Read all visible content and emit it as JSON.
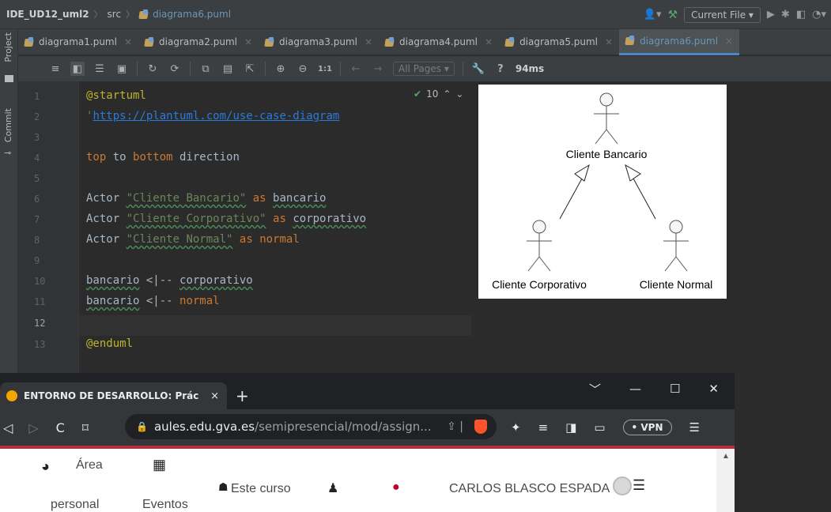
{
  "ide": {
    "breadcrumb": {
      "project": "IDE_UD12_uml2",
      "folder": "src",
      "file": "diagrama6.puml"
    },
    "run_config": "Current File ▾",
    "tool_windows": {
      "project": "Project",
      "commit": "Commit"
    },
    "tabs": [
      {
        "label": "diagrama1.puml",
        "active": false
      },
      {
        "label": "diagrama2.puml",
        "active": false
      },
      {
        "label": "diagrama3.puml",
        "active": false
      },
      {
        "label": "diagrama4.puml",
        "active": false
      },
      {
        "label": "diagrama5.puml",
        "active": false
      },
      {
        "label": "diagrama6.puml",
        "active": true
      }
    ],
    "toolbar": {
      "zoom_actual": "1:1",
      "pages": "All Pages",
      "help": "?",
      "timing": "94ms"
    },
    "inspections": {
      "count": "10"
    },
    "editor": {
      "line_numbers": [
        "1",
        "2",
        "3",
        "4",
        "5",
        "6",
        "7",
        "8",
        "9",
        "10",
        "11",
        "12",
        "13"
      ],
      "current_line": "12",
      "lines": [
        "@startuml",
        "'https://plantuml.com/use-case-diagram",
        "",
        "top to bottom direction",
        "",
        "Actor \"Cliente Bancario\" as bancario",
        "Actor \"Cliente Corporativo\" as corporativo",
        "Actor \"Cliente Normal\" as normal",
        "",
        "bancario <|-- corporativo",
        "bancario <|-- normal",
        "",
        "@enduml"
      ],
      "tokens": {
        "l1": "@startuml",
        "l2_quote": "'",
        "l2_url": "https://plantuml.com/use-case-diagram",
        "l4_kw1": "top",
        "l4_t1": " to ",
        "l4_kw2": "bottom",
        "l4_t2": " direction",
        "actor": "Actor",
        "as": "as",
        "l6_str": "\"Cliente Bancario\"",
        "l6_alias": "bancario",
        "l7_str": "\"Cliente Corporativo\"",
        "l7_alias": "corporativo",
        "l8_str": "\"Cliente Normal\"",
        "l8_alias": "normal",
        "l10_a": "bancario",
        "l10_op": " <|-- ",
        "l10_b": "corporativo",
        "l11_a": "bancario",
        "l11_op": " <|-- ",
        "l11_b": "normal",
        "l13": "@enduml"
      }
    },
    "diagram": {
      "actors": [
        {
          "label": "Cliente Bancario"
        },
        {
          "label": "Cliente Corporativo"
        },
        {
          "label": "Cliente Normal"
        }
      ]
    }
  },
  "browser": {
    "tab_title": "ENTORNO DE DESARROLLO: Prác",
    "tab_close": "×",
    "new_tab": "+",
    "window_controls": [
      "﹀",
      "—",
      "☐",
      "✕"
    ],
    "url_host": "aules.edu.gva.es",
    "url_path": "/semipresencial/mod/assign...",
    "vpn": "• VPN",
    "page": {
      "nav": [
        {
          "label": "Área",
          "label2": "personal"
        },
        {
          "label": "",
          "label2": "Eventos"
        },
        {
          "label": "Este curso"
        }
      ],
      "user": "CARLOS BLASCO ESPADA"
    }
  },
  "colors": {
    "ide_bg": "#2b2b2b",
    "ide_panel": "#3c3f41",
    "keyword": "#cc7832",
    "string": "#6a8759",
    "directive": "#bbb529",
    "url": "#287bde",
    "active_tab": "#6897bb",
    "browser_accent": "#b52e3b"
  },
  "icons": [
    "plantuml-file-icon",
    "person-icon",
    "hammer-icon",
    "run-icon",
    "debug-icon",
    "check-icon",
    "wrench-icon",
    "gauge-icon",
    "calendar-icon",
    "sitemap-icon",
    "bell-icon",
    "chat-icon",
    "avatar-icon",
    "lock-icon",
    "brave-icon",
    "puzzle-icon",
    "playlist-icon",
    "sidebar-icon",
    "wallet-icon",
    "menu-icon"
  ]
}
